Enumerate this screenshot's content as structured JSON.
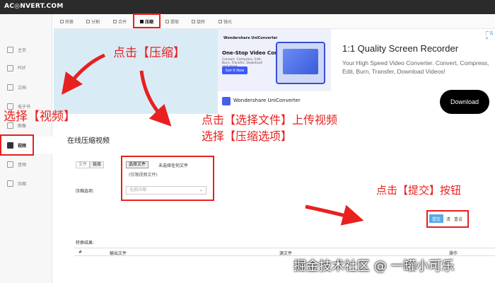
{
  "header": {
    "logo": "AC◎NVERT.COM"
  },
  "tabs": [
    {
      "label": "转换"
    },
    {
      "label": "分割"
    },
    {
      "label": "合并"
    },
    {
      "label": "压缩",
      "active": true
    },
    {
      "label": "提取"
    },
    {
      "label": "旋转"
    },
    {
      "label": "镜光"
    }
  ],
  "sidebar": {
    "items": [
      {
        "label": "主页",
        "icon": "home-icon"
      },
      {
        "label": "PDF",
        "icon": "pdf-icon"
      },
      {
        "label": "文档",
        "icon": "document-icon"
      },
      {
        "label": "电子书",
        "icon": "ebook-icon"
      },
      {
        "label": "图像",
        "icon": "image-icon"
      },
      {
        "label": "视频",
        "icon": "video-icon",
        "active": true
      },
      {
        "label": "音频",
        "icon": "audio-icon"
      },
      {
        "label": "压缩",
        "icon": "archive-icon"
      }
    ]
  },
  "ad": {
    "banner_brand": "Wondershare UniConverter",
    "banner_title": "One-Stop Video Converter",
    "banner_sub": "Convert, Compress, Edit, Burn, Transfer, Download and more",
    "banner_button": "Get It Now",
    "lower_text": "Wondershare UniConverter",
    "title": "1:1 Quality Screen Recorder",
    "description": "Your High Speed Video Converter. Convert, Compress, Edit, Burn, Transfer, Download Videos!",
    "button": "Download",
    "corner": "广告 ✕"
  },
  "form": {
    "section_title": "在线压缩视频",
    "mode_file": "文件",
    "mode_link": "链接",
    "file_button": "选择文件",
    "file_status": "未选择任何文件",
    "file_hint": "(仅限视频文件)",
    "option_label": "压缩选项:",
    "option_value": "无损压缩",
    "submit": "提交",
    "clear": "清",
    "reset": "重设"
  },
  "results": {
    "label": "转换结果:",
    "columns": [
      "#",
      "输出文件",
      "源文件",
      "操作"
    ]
  },
  "annotations": {
    "click_compress": "点击【压缩】",
    "select_video": "选择【视频】",
    "upload_line1": "点击【选择文件】上传视频",
    "upload_line2": "选择【压缩选项】",
    "click_submit": "点击【提交】按钮"
  },
  "watermark": "掘金技术社区 @ 一罐小可乐",
  "colors": {
    "annotation_red": "#e8201f",
    "panel_blue": "#d9ecf6",
    "submit_blue": "#5aa9e6",
    "header_dark": "#2b2b2b"
  }
}
